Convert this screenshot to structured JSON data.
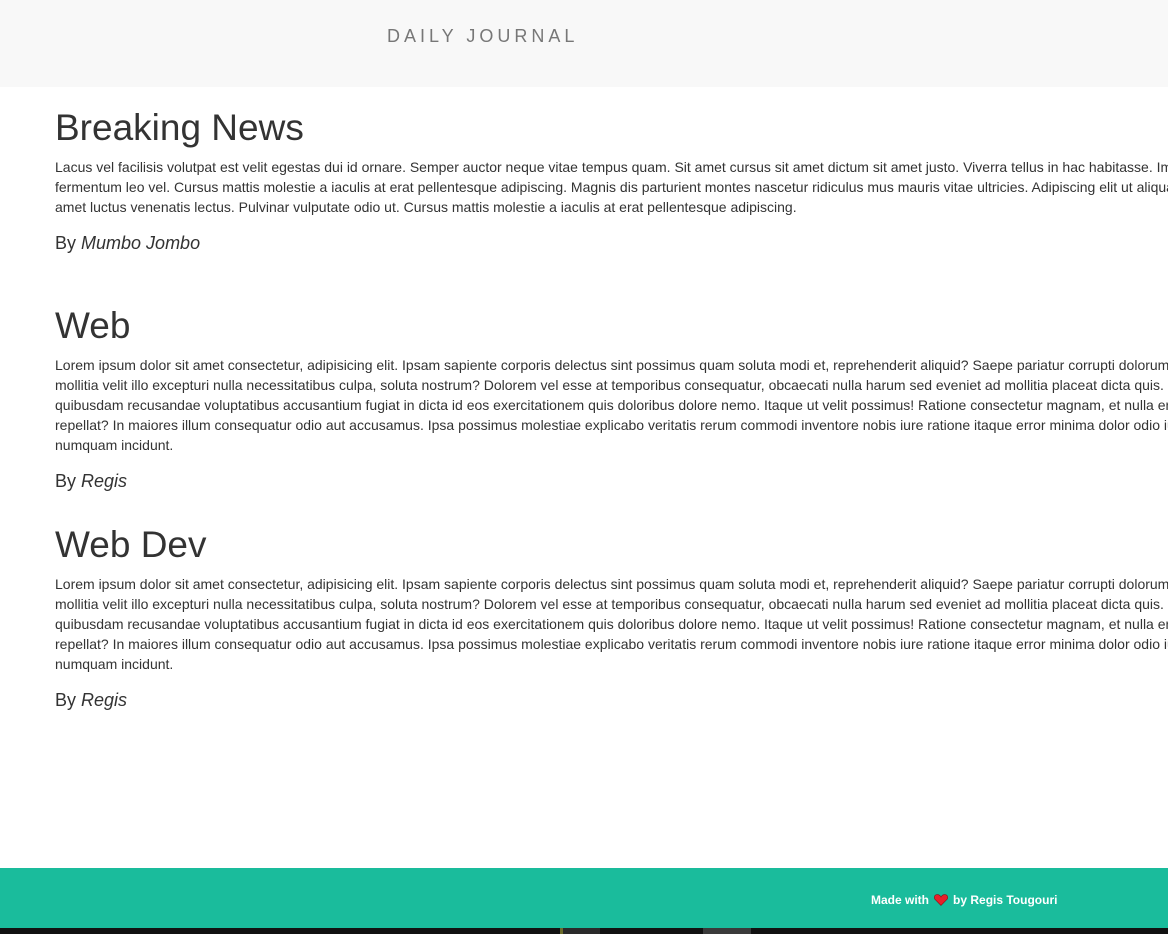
{
  "navbar": {
    "brand": "DAILY JOURNAL"
  },
  "posts": [
    {
      "title": "Breaking News",
      "body": "Lacus vel facilisis volutpat est velit egestas dui id ornare. Semper auctor neque vitae tempus quam. Sit amet cursus sit amet dictum sit amet justo. Viverra tellus in hac habitasse. Imperdiet proin fermentum leo vel. Cursus mattis molestie a iaculis at erat pellentesque adipiscing. Magnis dis parturient montes nascetur ridiculus mus mauris vitae ultricies. Adipiscing elit ut aliquam purus sit amet luctus venenatis lectus. Pulvinar vulputate odio ut. Cursus mattis molestie a iaculis at erat pellentesque adipiscing.",
      "by_label": "By",
      "author": "Mumbo Jombo"
    },
    {
      "title": "Web",
      "body": "Lorem ipsum dolor sit amet consectetur, adipisicing elit. Ipsam sapiente corporis delectus sint possimus quam soluta modi et, reprehenderit aliquid? Saepe pariatur corrupti dolorum sed esse, mollitia velit illo excepturi nulla necessitatibus culpa, soluta nostrum? Dolorem vel esse at temporibus consequatur, obcaecati nulla harum sed eveniet ad mollitia placeat dicta quis. Itaque quibusdam recusandae voluptatibus accusantium fugiat in dicta id eos exercitationem quis doloribus dolore nemo. Itaque ut velit possimus! Ratione consectetur magnam, et nulla enim blanditiis repellat? In maiores illum consequatur odio aut accusamus. Ipsa possimus molestiae explicabo veritatis rerum commodi inventore nobis iure ratione itaque error minima dolor odio iusto, est hic numquam incidunt.",
      "by_label": "By",
      "author": "Regis"
    },
    {
      "title": "Web Dev",
      "body": "Lorem ipsum dolor sit amet consectetur, adipisicing elit. Ipsam sapiente corporis delectus sint possimus quam soluta modi et, reprehenderit aliquid? Saepe pariatur corrupti dolorum sed esse, mollitia velit illo excepturi nulla necessitatibus culpa, soluta nostrum? Dolorem vel esse at temporibus consequatur, obcaecati nulla harum sed eveniet ad mollitia placeat dicta quis. Itaque quibusdam recusandae voluptatibus accusantium fugiat in dicta id eos exercitationem quis doloribus dolore nemo. Itaque ut velit possimus! Ratione consectetur magnam, et nulla enim blanditiis repellat? In maiores illum consequatur odio aut accusamus. Ipsa possimus molestiae explicabo veritatis rerum commodi inventore nobis iure ratione itaque error minima dolor odio iusto, est hic numquam incidunt.",
      "by_label": "By",
      "author": "Regis"
    }
  ],
  "footer": {
    "made_with": "Made with",
    "by_text": "by Regis Tougouri",
    "icon": "heart-icon"
  },
  "colors": {
    "footer_bg": "#1abc9c",
    "navbar_bg": "#f8f8f8",
    "heart": "#e8202a"
  }
}
